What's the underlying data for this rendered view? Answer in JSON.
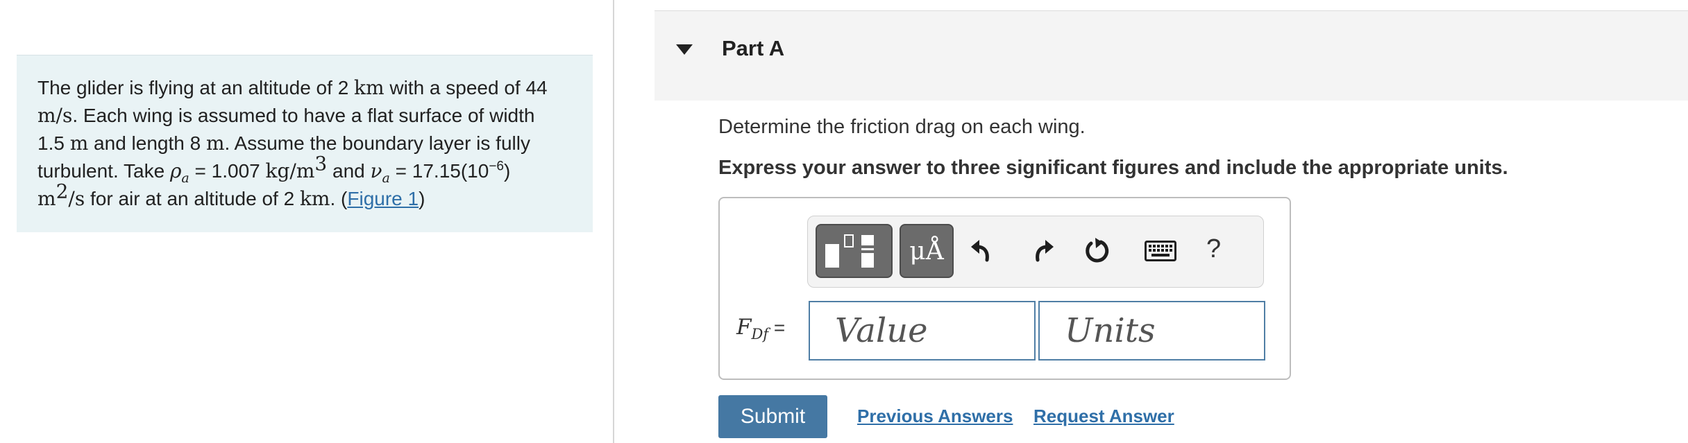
{
  "problem": {
    "s1": "The glider is flying at an altitude of 2 ",
    "km": "km",
    "s2": " with a speed of 44",
    "ms": "m/s",
    "s3": ". Each wing is assumed to have a flat surface of width",
    "s4": "1.5 ",
    "m1": "m",
    "s5": " and length 8 ",
    "m2": "m",
    "s6": ". Assume the boundary layer is fully",
    "s7": "turbulent. Take ",
    "rho": "ρ",
    "rho_sub": "a",
    "s8": " = 1.007 ",
    "kgm": "kg/m",
    "exp3": "3",
    "s9": " and ",
    "nu": "ν",
    "nu_sub": "a",
    "s10": " = 17.15(10",
    "exp_neg6": "−6",
    "s11": ")",
    "m3": "m",
    "exp2": "2",
    "per_s": "/s",
    "s12": " for air at an altitude of 2 ",
    "km2": "km",
    "s13": ". (",
    "figure_link": "Figure 1",
    "s14": ")"
  },
  "part": {
    "title": "Part A"
  },
  "question": "Determine the friction drag on each wing.",
  "instructions": "Express your answer to three significant figures and include the appropriate units.",
  "toolbar": {
    "symbols_label": "μÅ",
    "help_label": "?"
  },
  "answer": {
    "label_main": "F",
    "label_sub": "Df",
    "label_eq": " =",
    "value_placeholder": "Value",
    "units_placeholder": "Units"
  },
  "buttons": {
    "submit": "Submit",
    "previous_answers": "Previous Answers",
    "request_answer": "Request Answer"
  }
}
